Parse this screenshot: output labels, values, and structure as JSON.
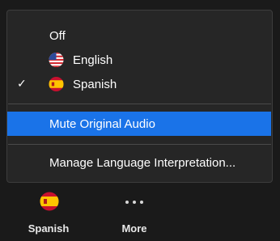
{
  "menu": {
    "items": [
      {
        "label": "Off",
        "checked": false,
        "icon": null
      },
      {
        "label": "English",
        "checked": false,
        "icon": "us-flag-icon"
      },
      {
        "label": "Spanish",
        "checked": true,
        "icon": "spain-flag-icon"
      }
    ],
    "check_glyph": "✓",
    "mute_original_audio": "Mute Original Audio",
    "manage_language_interpretation": "Manage Language Interpretation..."
  },
  "toolbar": {
    "interpretation_label": "Spanish",
    "interpretation_icon": "spain-flag-icon",
    "more_label": "More",
    "more_icon": "more-dots-icon"
  },
  "colors": {
    "menu_bg": "#262626",
    "highlight": "#1a73e8",
    "page_bg": "#1a1a1a"
  }
}
